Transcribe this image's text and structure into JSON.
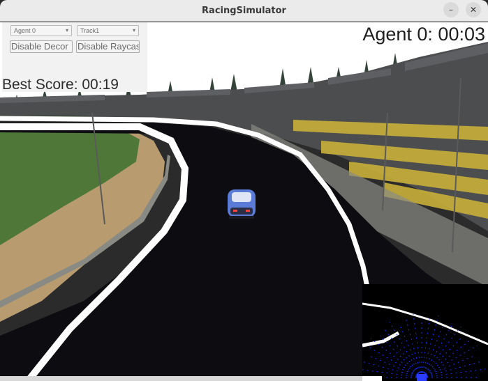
{
  "window": {
    "title": "RacingSimulator",
    "minimize_glyph": "–",
    "close_glyph": "✕"
  },
  "controls": {
    "agent_select": {
      "value": "Agent 0"
    },
    "track_select": {
      "value": "Track1"
    },
    "disable_decor_button": "Disable Decor",
    "disable_raycast_button": "Disable Raycast"
  },
  "hud": {
    "agent_timer": "Agent 0: 00:03",
    "best_score": "Best Score: 00:19"
  },
  "colors": {
    "asphalt": "#0d0c10",
    "track_line": "#ffffff",
    "grass": "#4f7838",
    "dirt": "#b89c70",
    "sky": "#ffffff",
    "raycast": "#1a2fff",
    "stands": "#4c4d4f"
  }
}
